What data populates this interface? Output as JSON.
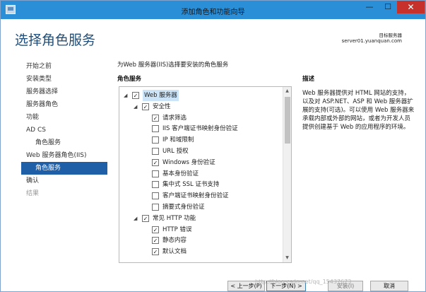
{
  "window": {
    "title": "添加角色和功能向导",
    "controls": {
      "minimize": "—",
      "maximize": "☐",
      "close": "✕"
    }
  },
  "header": {
    "page_title": "选择角色服务",
    "target_label": "目标服务器",
    "target_server": "server01.yuanquan.com"
  },
  "nav": {
    "items": [
      {
        "label": "开始之前"
      },
      {
        "label": "安装类型"
      },
      {
        "label": "服务器选择"
      },
      {
        "label": "服务器角色"
      },
      {
        "label": "功能"
      },
      {
        "label": "AD CS"
      },
      {
        "label": "角色服务"
      },
      {
        "label": "Web 服务器角色(IIS)"
      },
      {
        "label": "角色服务"
      },
      {
        "label": "确认"
      },
      {
        "label": "结果"
      }
    ]
  },
  "main": {
    "instruction": "为Web 服务器(IIS)选择要安装的角色服务",
    "roles_heading": "角色服务",
    "description_heading": "描述",
    "description": "Web 服务器提供对 HTML 网站的支持，以及对 ASP.NET、ASP 和 Web 服务器扩展的支持(可选)。可以使用 Web 服务器来承载内部或外部的网站，或者为开发人员提供创建基于 Web 的应用程序的环境。",
    "tree": [
      {
        "label": "Web 服务器",
        "checked": true,
        "expander": "◢"
      },
      {
        "label": "安全性",
        "checked": true,
        "expander": "◢"
      },
      {
        "label": "请求筛选",
        "checked": true
      },
      {
        "label": "IIS 客户端证书映射身份验证",
        "checked": false
      },
      {
        "label": "IP 和域限制",
        "checked": false
      },
      {
        "label": "URL 授权",
        "checked": false
      },
      {
        "label": "Windows 身份验证",
        "checked": true
      },
      {
        "label": "基本身份验证",
        "checked": false
      },
      {
        "label": "集中式 SSL 证书支持",
        "checked": false
      },
      {
        "label": "客户端证书映射身份验证",
        "checked": false
      },
      {
        "label": "摘要式身份验证",
        "checked": false
      },
      {
        "label": "常见 HTTP 功能",
        "checked": true,
        "expander": "◢"
      },
      {
        "label": "HTTP 错误",
        "checked": true
      },
      {
        "label": "静态内容",
        "checked": true
      },
      {
        "label": "默认文档",
        "checked": true
      }
    ],
    "scroll_up": "▲",
    "scroll_down": "▼"
  },
  "footer": {
    "prev": "< 上一步(P)",
    "next": "下一步(N) >",
    "install": "安装(I)",
    "cancel": "取消"
  },
  "watermark": "http://blog.csdn.net/qq_15437673",
  "colors": {
    "titlebar": "#2b8fd8",
    "close_button": "#c7312c",
    "nav_active": "#1f5fa8",
    "page_title": "#1f4e7a",
    "selection": "#cce4f7"
  }
}
